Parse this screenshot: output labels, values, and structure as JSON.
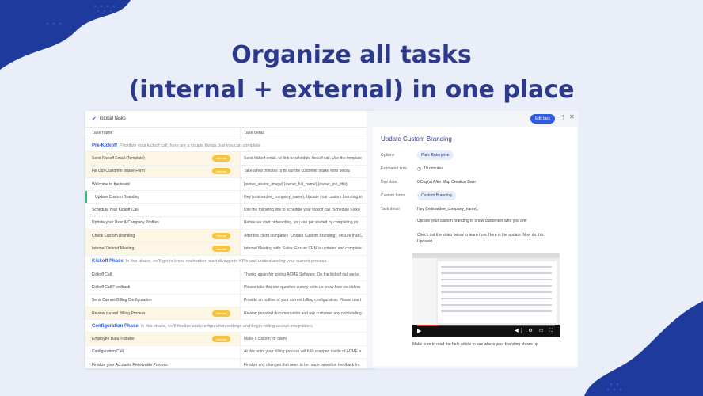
{
  "headline": {
    "line1": "Organize all tasks",
    "line2": "(internal + external) in one place"
  },
  "colors": {
    "accent": "#2d5be3",
    "headline": "#2d3a8c",
    "badge": "#f5c542",
    "selected": "#2fbf71",
    "blob": "#1e3a9c"
  },
  "task_table": {
    "title": "Global tasks",
    "check_icon": "check-icon",
    "columns": [
      "Task name",
      "Task detail"
    ],
    "sections": [
      {
        "phase_name": "Pre-Kickoff",
        "phase_desc": "Prioritize your kickoff call, here are a couple things that you can complete",
        "rows": [
          {
            "name": "Send Kickoff Email (Template)",
            "badge": "Internal",
            "detail": "Send kickoff email, w/ link to schedule kickoff call. Use the template"
          },
          {
            "name": "Fill Out Customer Intake Form",
            "badge": "Internal",
            "detail": "Take a few minutes to fill out the customer intake form below."
          },
          {
            "name": "Welcome to the team!",
            "badge": "",
            "detail": "[owner_avatar_image] {owner_full_name} {owner_job_title}"
          },
          {
            "name": "Update Custom Branding",
            "badge": "",
            "detail": "Hey {onboardee_company_name}, Update your custom branding to",
            "selected": true
          },
          {
            "name": "Schedule Your Kickoff Call",
            "badge": "",
            "detail": "Use the following link to schedule your kickoff call. Schedule Kicko"
          },
          {
            "name": "Update your User & Company Profiles",
            "badge": "",
            "detail": "Before we start onboarding, you can get started by completing yo"
          },
          {
            "name": "Check Custom Branding",
            "badge": "Internal",
            "detail": "After the client completes \"Update Custom Branding\", ensure that C"
          },
          {
            "name": "Internal Debrief Meeting",
            "badge": "Internal",
            "detail": "Internal Meeting with: Sales: Ensure CRM is updated and complete"
          }
        ]
      },
      {
        "phase_name": "Kickoff Phase",
        "phase_desc": "In this phase, we'll get to know each other, start diving into KPIs and understanding your current process.",
        "rows": [
          {
            "name": "Kickoff Call",
            "badge": "",
            "detail": "Thanks again for joining ACME Software. On the kickoff call we wi"
          },
          {
            "name": "Kickoff Call Feedback",
            "badge": "",
            "detail": "Please take this one question survey to let us know how we did on"
          },
          {
            "name": "Send Current Billing Configuration",
            "badge": "",
            "detail": "Provide an outline of your current billing configuration. Please use t"
          },
          {
            "name": "Review current Billing Process",
            "badge": "Internal",
            "detail": "Review provided documentation and ask customer any outstanding"
          }
        ]
      },
      {
        "phase_name": "Configuration Phase",
        "phase_desc": "In this phase, we'll finalize and configuration settings and begin rolling accept integrations.",
        "rows": [
          {
            "name": "Employee Data Transfer",
            "badge": "Internal",
            "detail": "Make it custom for client"
          },
          {
            "name": "Configuration Call",
            "badge": "",
            "detail": "At this point your billing process will fully mapped inside of ACME a"
          },
          {
            "name": "Finalize your Accounts Receivable Process",
            "badge": "",
            "detail": "Finalize any changes that need to be made based on feedback fro"
          }
        ]
      }
    ]
  },
  "detail_panel": {
    "edit_label": "Edit task",
    "more_icon": "more-vertical-icon",
    "close_icon": "close-icon",
    "title": "Update Custom Branding",
    "options_label": "Options",
    "options_value": "Plan: Enterprise",
    "estimated_label": "Estimated time",
    "estimated_value": "10 minutes",
    "clock_icon": "clock-icon",
    "due_label": "Due date",
    "due_value": "0 Day(s) After Map Creation Date",
    "forms_label": "Custom forms",
    "forms_value": "Custom Branding",
    "detail_label": "Task detail",
    "detail_lines": [
      "Hey {onboardee_company_name},",
      "Update your custom branding to show customers who you are!",
      "Check out the video below to learn how. Here is the update. Now do this:",
      "Updated."
    ],
    "video": {
      "time": "0:18",
      "play_icon": "play-icon",
      "progress": 0.15
    },
    "footer_text": "Make sure to read the help article to see where your branding shows up"
  }
}
